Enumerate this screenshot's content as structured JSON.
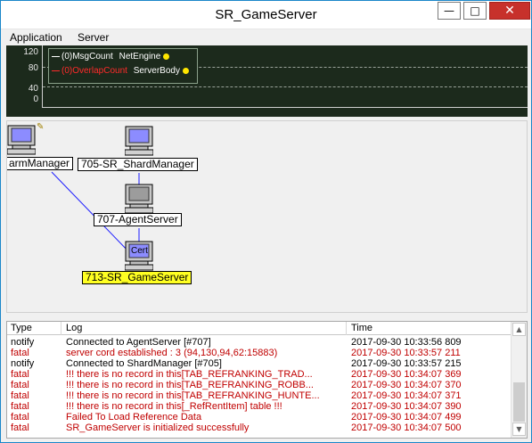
{
  "window": {
    "title": "SR_GameServer"
  },
  "titlebar_buttons": {
    "minimize": "—",
    "maximize": "□",
    "close": "✕"
  },
  "menu": [
    "Application",
    "Server"
  ],
  "monitor": {
    "y_ticks": [
      "120",
      "80",
      "40",
      "0"
    ],
    "legend": [
      {
        "prefix": "(0)MsgCount",
        "name": "NetEngine",
        "color": "#ffffff"
      },
      {
        "prefix": "(0)OverlapCount",
        "name": "ServerBody",
        "color": "#ff2a2a"
      }
    ]
  },
  "diagram": {
    "nodes": [
      {
        "label": "armManager",
        "icon": "computer-icon",
        "has_badge": true
      },
      {
        "label": "705-SR_ShardManager",
        "icon": "computer-icon"
      },
      {
        "label": "707-AgentServer",
        "icon": "computer-icon"
      },
      {
        "label": "713-SR_GameServer",
        "icon": "computer-icon",
        "icon_text": "Cert",
        "active": true
      }
    ]
  },
  "log": {
    "columns": [
      "Type",
      "Log",
      "Time"
    ],
    "rows": [
      {
        "type": "notify",
        "log": "Connected to AgentServer [#707]",
        "time": "2017-09-30 10:33:56 809",
        "color": "#000000"
      },
      {
        "type": "fatal",
        "log": "server cord established : 3 (94,130,94,62:15883)",
        "time": "2017-09-30 10:33:57 211",
        "color": "#c00000"
      },
      {
        "type": "notify",
        "log": "Connected to ShardManager [#705]",
        "time": "2017-09-30 10:33:57 215",
        "color": "#000000"
      },
      {
        "type": "fatal",
        "log": "!!! there is no record in this[TAB_REFRANKING_TRAD...",
        "time": "2017-09-30 10:34:07 369",
        "color": "#c00000"
      },
      {
        "type": "fatal",
        "log": "!!! there is no record in this[TAB_REFRANKING_ROBB...",
        "time": "2017-09-30 10:34:07 370",
        "color": "#c00000"
      },
      {
        "type": "fatal",
        "log": "!!! there is no record in this[TAB_REFRANKING_HUNTE...",
        "time": "2017-09-30 10:34:07 371",
        "color": "#c00000"
      },
      {
        "type": "fatal",
        "log": "!!! there is no record in this[_RefRentItem] table !!!",
        "time": "2017-09-30 10:34:07 390",
        "color": "#c00000"
      },
      {
        "type": "fatal",
        "log": "Failed To Load Reference Data",
        "time": "2017-09-30 10:34:07 499",
        "color": "#c00000"
      },
      {
        "type": "fatal",
        "log": "SR_GameServer is initialized successfully",
        "time": "2017-09-30 10:34:07 500",
        "color": "#c00000"
      }
    ]
  }
}
